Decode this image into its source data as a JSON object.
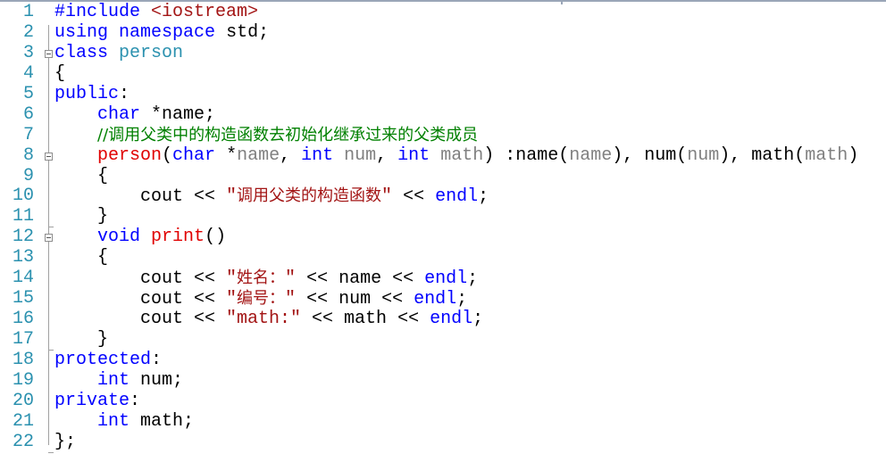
{
  "editor": {
    "language": "C++",
    "colors": {
      "line_number": "#2b91af",
      "keyword": "#0000ff",
      "type_name": "#2b91af",
      "function": "#e00000",
      "string": "#a31515",
      "comment": "#008000",
      "parameter": "#808080",
      "plain": "#000000"
    },
    "lines": [
      {
        "n": "1",
        "fold": "",
        "tokens": [
          [
            "pp",
            "#include "
          ],
          [
            "inc",
            "<iostream>"
          ]
        ]
      },
      {
        "n": "2",
        "fold": "",
        "tokens": [
          [
            "kw",
            "using"
          ],
          [
            "plain",
            " "
          ],
          [
            "kw",
            "namespace"
          ],
          [
            "plain",
            " std;"
          ]
        ]
      },
      {
        "n": "3",
        "fold": "open",
        "tokens": [
          [
            "kw",
            "class"
          ],
          [
            "plain",
            " "
          ],
          [
            "type",
            "person"
          ]
        ]
      },
      {
        "n": "4",
        "fold": "",
        "tokens": [
          [
            "plain",
            "{"
          ]
        ]
      },
      {
        "n": "5",
        "fold": "",
        "tokens": [
          [
            "kw",
            "public"
          ],
          [
            "plain",
            ":"
          ]
        ]
      },
      {
        "n": "6",
        "fold": "",
        "tokens": [
          [
            "plain",
            "    "
          ],
          [
            "kw",
            "char"
          ],
          [
            "plain",
            " *name;"
          ]
        ]
      },
      {
        "n": "7",
        "fold": "",
        "tokens": [
          [
            "plain",
            "    "
          ],
          [
            "cmt",
            "//调用父类中的构造函数去初始化继承过来的父类成员"
          ]
        ]
      },
      {
        "n": "8",
        "fold": "open",
        "tokens": [
          [
            "plain",
            "    "
          ],
          [
            "fn",
            "person"
          ],
          [
            "plain",
            "("
          ],
          [
            "kw",
            "char"
          ],
          [
            "plain",
            " *"
          ],
          [
            "param",
            "name"
          ],
          [
            "plain",
            ", "
          ],
          [
            "kw",
            "int"
          ],
          [
            "plain",
            " "
          ],
          [
            "param",
            "num"
          ],
          [
            "plain",
            ", "
          ],
          [
            "kw",
            "int"
          ],
          [
            "plain",
            " "
          ],
          [
            "param",
            "math"
          ],
          [
            "plain",
            ") :name("
          ],
          [
            "param",
            "name"
          ],
          [
            "plain",
            "), num("
          ],
          [
            "param",
            "num"
          ],
          [
            "plain",
            "), math("
          ],
          [
            "param",
            "math"
          ],
          [
            "plain",
            ")"
          ]
        ]
      },
      {
        "n": "9",
        "fold": "",
        "tokens": [
          [
            "plain",
            "    {"
          ]
        ]
      },
      {
        "n": "10",
        "fold": "",
        "tokens": [
          [
            "plain",
            "        cout << "
          ],
          [
            "str",
            "\"调用父类的构造函数\""
          ],
          [
            "plain",
            " << "
          ],
          [
            "kw",
            "endl"
          ],
          [
            "plain",
            ";"
          ]
        ]
      },
      {
        "n": "11",
        "fold": "end",
        "tokens": [
          [
            "plain",
            "    }"
          ]
        ]
      },
      {
        "n": "12",
        "fold": "open",
        "tokens": [
          [
            "plain",
            "    "
          ],
          [
            "kw",
            "void"
          ],
          [
            "plain",
            " "
          ],
          [
            "fn",
            "print"
          ],
          [
            "plain",
            "()"
          ]
        ]
      },
      {
        "n": "13",
        "fold": "",
        "tokens": [
          [
            "plain",
            "    {"
          ]
        ]
      },
      {
        "n": "14",
        "fold": "",
        "tokens": [
          [
            "plain",
            "        cout << "
          ],
          [
            "str",
            "\"姓名：\""
          ],
          [
            "plain",
            " << name << "
          ],
          [
            "kw",
            "endl"
          ],
          [
            "plain",
            ";"
          ]
        ]
      },
      {
        "n": "15",
        "fold": "",
        "tokens": [
          [
            "plain",
            "        cout << "
          ],
          [
            "str",
            "\"编号：\""
          ],
          [
            "plain",
            " << num << "
          ],
          [
            "kw",
            "endl"
          ],
          [
            "plain",
            ";"
          ]
        ]
      },
      {
        "n": "16",
        "fold": "",
        "tokens": [
          [
            "plain",
            "        cout << "
          ],
          [
            "str",
            "\"math:\""
          ],
          [
            "plain",
            " << math << "
          ],
          [
            "kw",
            "endl"
          ],
          [
            "plain",
            ";"
          ]
        ]
      },
      {
        "n": "17",
        "fold": "end",
        "tokens": [
          [
            "plain",
            "    }"
          ]
        ]
      },
      {
        "n": "18",
        "fold": "",
        "tokens": [
          [
            "kw",
            "protected"
          ],
          [
            "plain",
            ":"
          ]
        ]
      },
      {
        "n": "19",
        "fold": "",
        "tokens": [
          [
            "plain",
            "    "
          ],
          [
            "kw",
            "int"
          ],
          [
            "plain",
            " num;"
          ]
        ]
      },
      {
        "n": "20",
        "fold": "",
        "tokens": [
          [
            "kw",
            "private"
          ],
          [
            "plain",
            ":"
          ]
        ]
      },
      {
        "n": "21",
        "fold": "",
        "tokens": [
          [
            "plain",
            "    "
          ],
          [
            "kw",
            "int"
          ],
          [
            "plain",
            " math;"
          ]
        ]
      },
      {
        "n": "22",
        "fold": "end",
        "tokens": [
          [
            "plain",
            "};"
          ]
        ]
      }
    ]
  }
}
